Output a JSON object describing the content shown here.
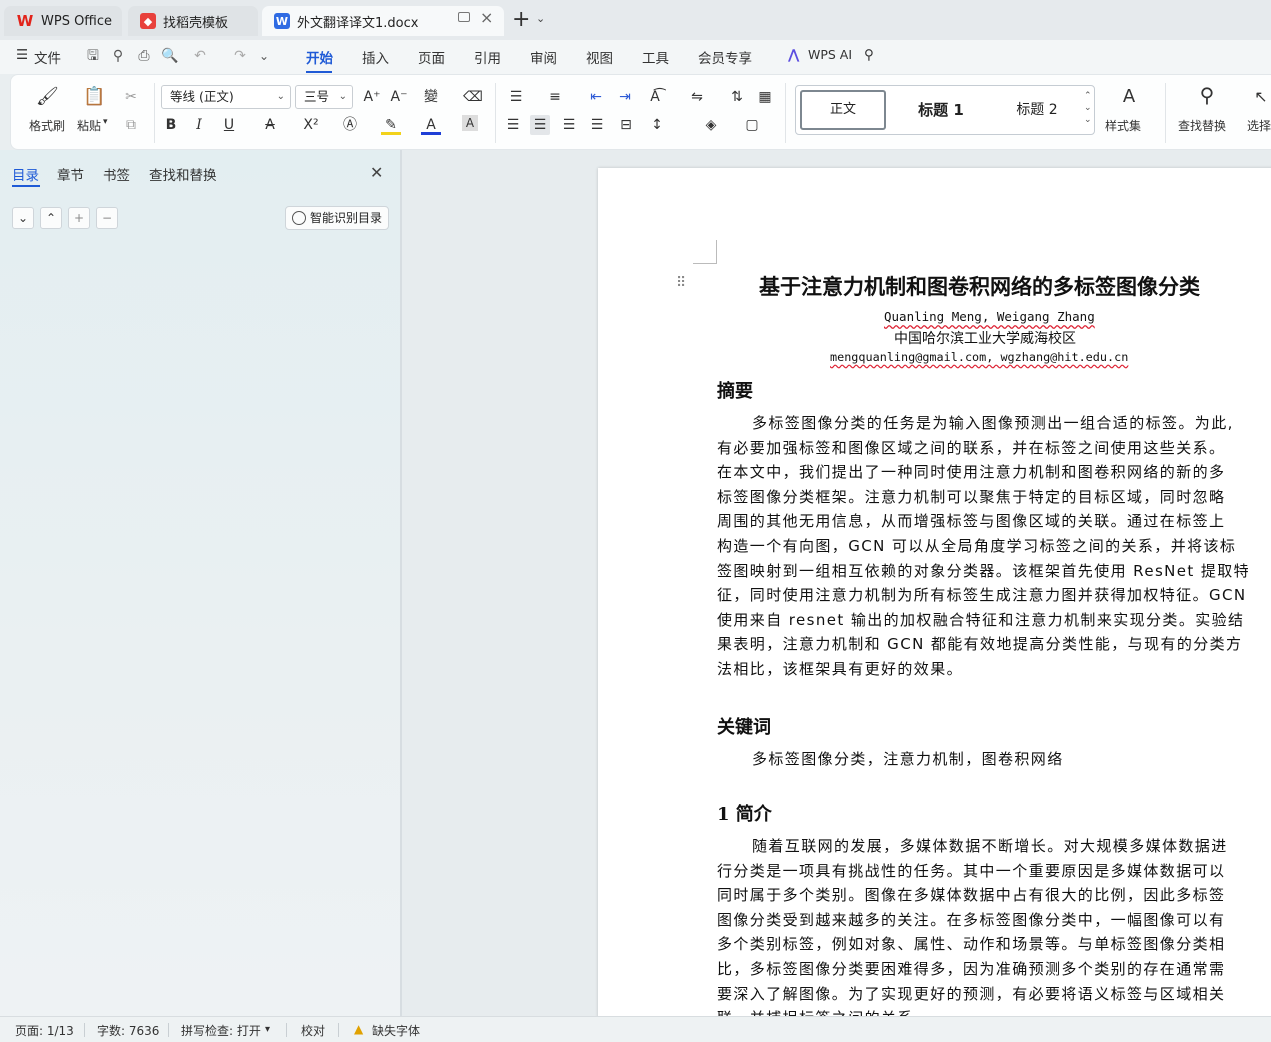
{
  "tabs": [
    {
      "label": "WPS Office",
      "icon": "wps-logo-icon"
    },
    {
      "label": "找稻壳模板",
      "icon": "docer-icon"
    },
    {
      "label": "外文翻译译文1.docx",
      "icon": "word-doc-icon"
    }
  ],
  "menu": {
    "file": "文件",
    "items": [
      "开始",
      "插入",
      "页面",
      "引用",
      "审阅",
      "视图",
      "工具",
      "会员专享"
    ],
    "wps_ai": "WPS AI"
  },
  "ribbon": {
    "format_painter": "格式刷",
    "paste": "粘贴",
    "font": "等线 (正文)",
    "font_size": "三号",
    "styles": [
      "正文",
      "标题 1",
      "标题 2"
    ],
    "style_set": "样式集",
    "find_replace": "查找替换",
    "select": "选择"
  },
  "side_panel": {
    "tabs": [
      "目录",
      "章节",
      "书签",
      "查找和替换"
    ],
    "smart_toc": "智能识别目录"
  },
  "document": {
    "title": "基于注意力机制和图卷积网络的多标签图像分类",
    "authors": "Quanling Meng, Weigang Zhang",
    "affiliation": "中国哈尔滨工业大学威海校区",
    "emails": "mengquanling@gmail.com, wgzhang@hit.edu.cn",
    "abstract_heading": "摘要",
    "abstract_lines": [
      "多标签图像分类的任务是为输入图像预测出一组合适的标签。为此,",
      "有必要加强标签和图像区域之间的联系，并在标签之间使用这些关系。",
      "在本文中，我们提出了一种同时使用注意力机制和图卷积网络的新的多",
      "标签图像分类框架。注意力机制可以聚焦于特定的目标区域，同时忽略",
      "周围的其他无用信息，从而增强标签与图像区域的关联。通过在标签上",
      "构造一个有向图，GCN 可以从全局角度学习标签之间的关系，并将该标",
      "签图映射到一组相互依赖的对象分类器。该框架首先使用 ResNet 提取特",
      "征，同时使用注意力机制为所有标签生成注意力图并获得加权特征。GCN",
      "使用来自 resnet 输出的加权融合特征和注意力机制来实现分类。实验结",
      "果表明，注意力机制和 GCN 都能有效地提高分类性能，与现有的分类方",
      "法相比，该框架具有更好的效果。"
    ],
    "keywords_heading": "关键词",
    "keywords": "多标签图像分类，注意力机制，图卷积网络",
    "intro_heading": "1 简介",
    "intro_lines": [
      "随着互联网的发展，多媒体数据不断增长。对大规模多媒体数据进",
      "行分类是一项具有挑战性的任务。其中一个重要原因是多媒体数据可以",
      "同时属于多个类别。图像在多媒体数据中占有很大的比例，因此多标签",
      "图像分类受到越来越多的关注。在多标签图像分类中，一幅图像可以有",
      "多个类别标签，例如对象、属性、动作和场景等。与单标签图像分类相",
      "比，多标签图像分类要困难得多，因为准确预测多个类别的存在通常需",
      "要深入了解图像。为了实现更好的预测，有必要将语义标签与区域相关",
      "联，并捕捉标签之间的关系。"
    ]
  },
  "status": {
    "page": "页面: 1/13",
    "words": "字数: 7636",
    "spell": "拼写检查: 打开",
    "proof": "校对",
    "missing_font": "缺失字体"
  }
}
